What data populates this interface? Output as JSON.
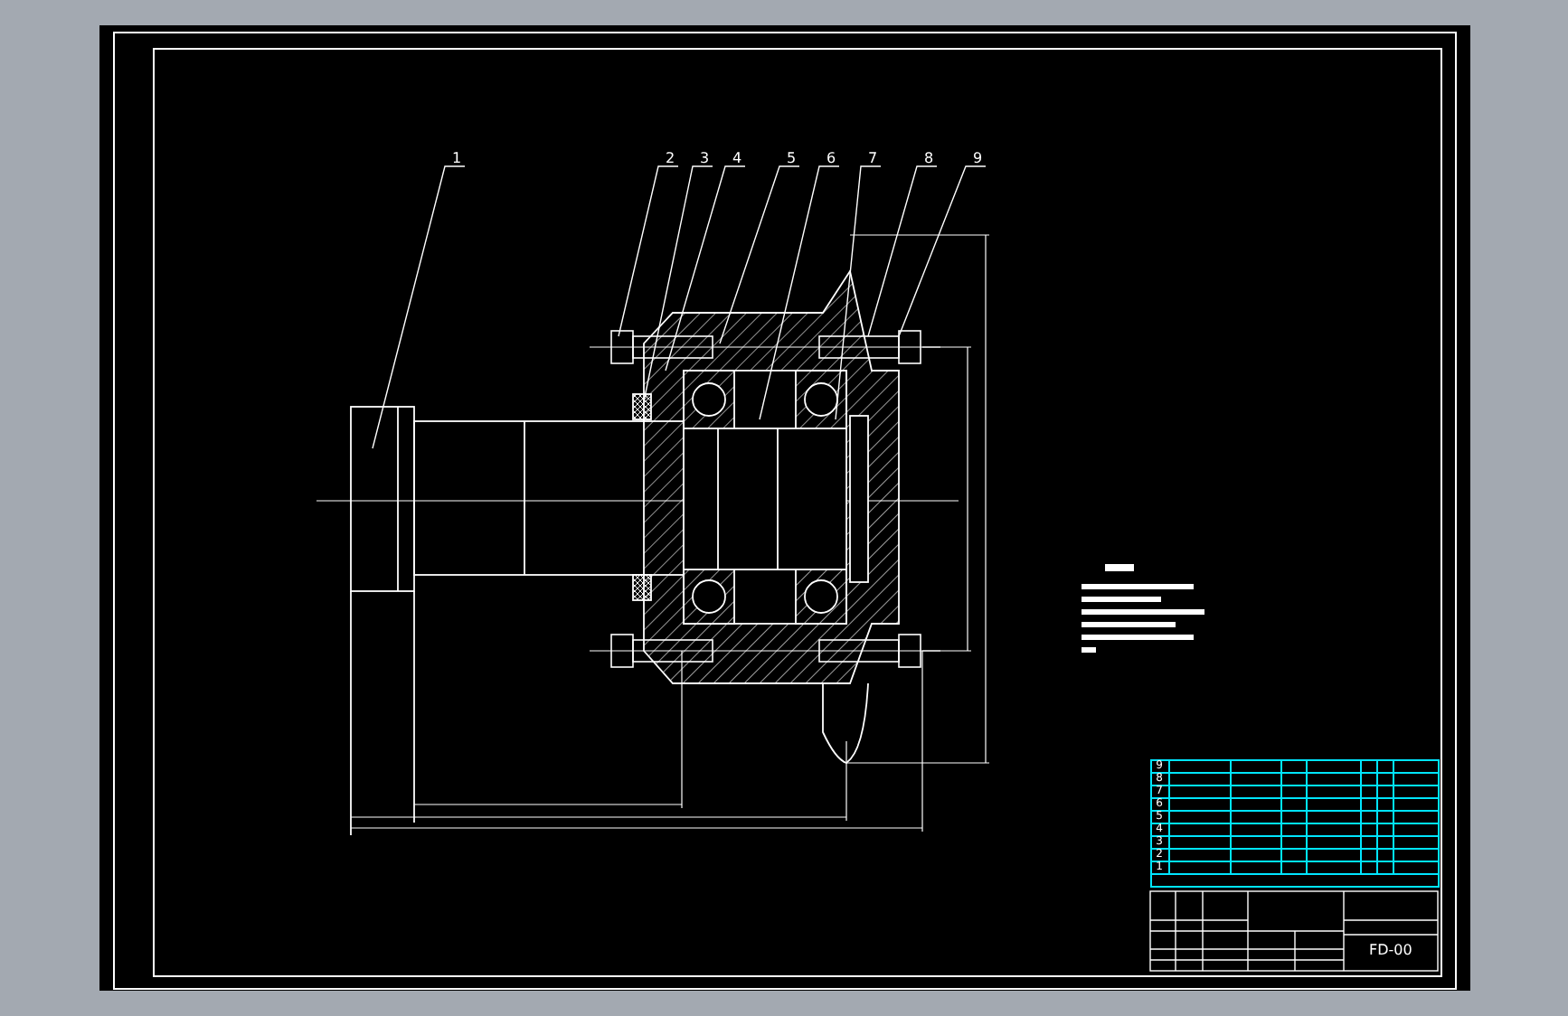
{
  "balloons": [
    {
      "label": "1"
    },
    {
      "label": "2"
    },
    {
      "label": "3"
    },
    {
      "label": "4"
    },
    {
      "label": "5"
    },
    {
      "label": "6"
    },
    {
      "label": "7"
    },
    {
      "label": "8"
    },
    {
      "label": "9"
    }
  ],
  "parts_list": {
    "rows": [
      {
        "no": "9"
      },
      {
        "no": "8"
      },
      {
        "no": "7"
      },
      {
        "no": "6"
      },
      {
        "no": "5"
      },
      {
        "no": "4"
      },
      {
        "no": "3"
      },
      {
        "no": "2"
      },
      {
        "no": "1"
      }
    ]
  },
  "title_block": {
    "drawing_number": "FD-00"
  }
}
